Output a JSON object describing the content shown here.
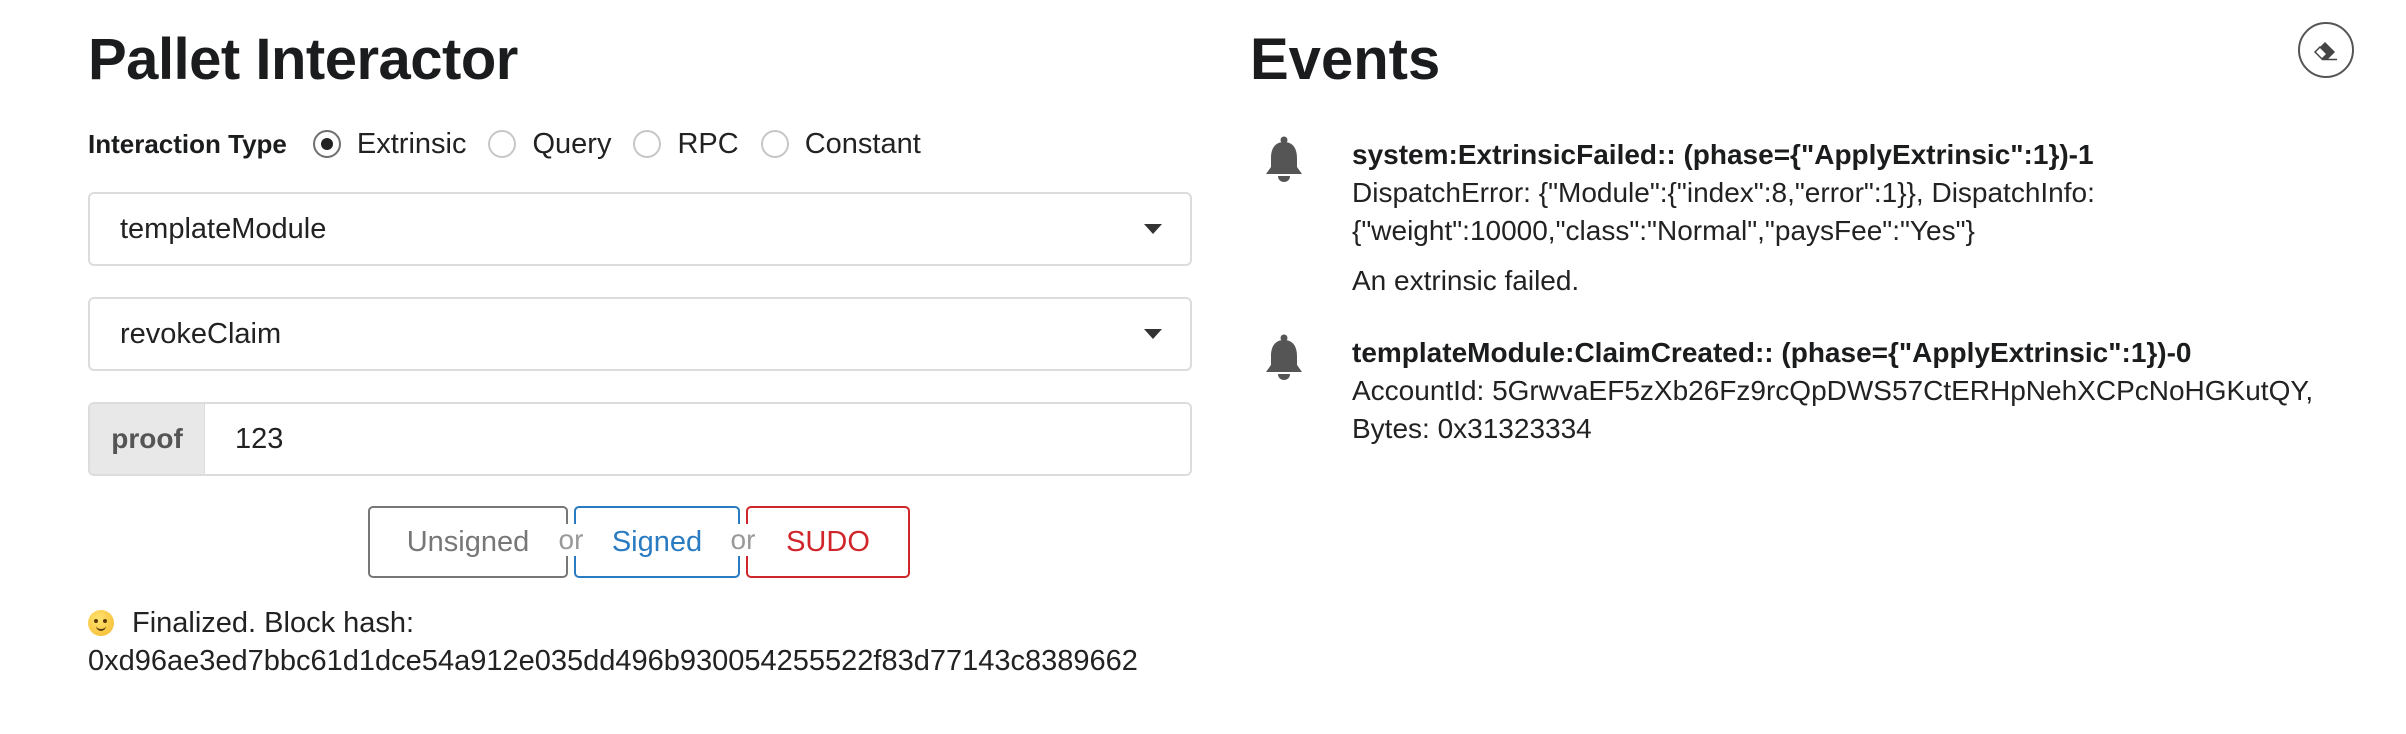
{
  "pallet": {
    "title": "Pallet Interactor",
    "interaction_label": "Interaction Type",
    "interaction_options": [
      {
        "label": "Extrinsic",
        "checked": true
      },
      {
        "label": "Query",
        "checked": false
      },
      {
        "label": "RPC",
        "checked": false
      },
      {
        "label": "Constant",
        "checked": false
      }
    ],
    "module_dropdown": "templateModule",
    "callable_dropdown": "revokeClaim",
    "param_label": "proof",
    "param_value": "123",
    "buttons": {
      "unsigned": "Unsigned",
      "or": "or",
      "signed": "Signed",
      "sudo": "SUDO"
    },
    "status_line1": "Finalized. Block hash:",
    "status_line2": "0xd96ae3ed7bbc61d1dce54a912e035dd496b930054255522f83d77143c8389662",
    "status_icon": "wink-emoji-icon"
  },
  "events": {
    "title": "Events",
    "clear_icon": "eraser-icon",
    "items": [
      {
        "icon": "bell-icon",
        "title": "system:ExtrinsicFailed:: (phase={\"ApplyExtrinsic\":1})-1",
        "body": "DispatchError: {\"Module\":{\"index\":8,\"error\":1}}, DispatchInfo: {\"weight\":10000,\"class\":\"Normal\",\"paysFee\":\"Yes\"}",
        "desc": "An extrinsic failed."
      },
      {
        "icon": "bell-icon",
        "title": "templateModule:ClaimCreated:: (phase={\"ApplyExtrinsic\":1})-0",
        "body": "AccountId: 5GrwvaEF5zXb26Fz9rcQpDWS57CtERHpNehXCPcNoHGKutQY, Bytes: 0x31323334"
      }
    ]
  },
  "colors": {
    "signed": "#2a7bc2",
    "sudo": "#d0262b",
    "unsigned": "#777777"
  }
}
